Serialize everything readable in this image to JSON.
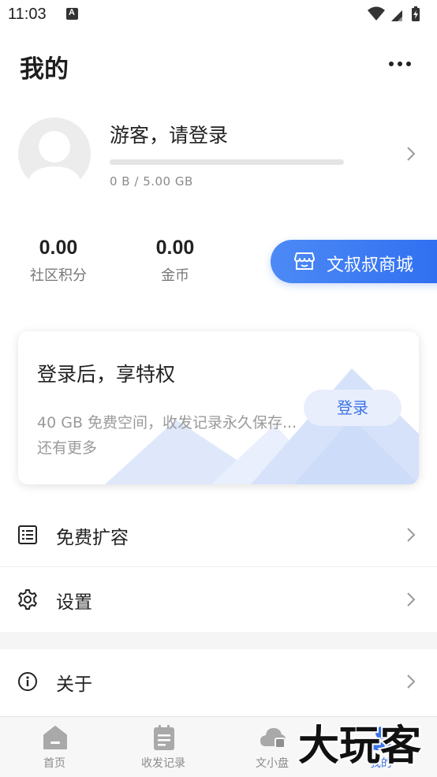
{
  "status_bar": {
    "time": "11:03",
    "notification_letter": "A",
    "icons": [
      "wifi-icon",
      "signal-icon",
      "battery-icon"
    ]
  },
  "header": {
    "title": "我的",
    "more_icon": "more-icon"
  },
  "profile": {
    "name": "游客，请登录",
    "storage_text": "0 B / 5.00 GB",
    "storage_used_fraction": 0,
    "avatar_icon": "avatar-placeholder-icon"
  },
  "stats": [
    {
      "value": "0.00",
      "label": "社区积分"
    },
    {
      "value": "0.00",
      "label": "金币"
    }
  ],
  "shop_button": {
    "label": "文叔叔商城",
    "icon": "store-icon"
  },
  "login_card": {
    "title": "登录后，享特权",
    "description": "40 GB 免费空间，收发记录永久保存... 还有更多",
    "button_label": "登录"
  },
  "menu": [
    {
      "label": "免费扩容",
      "icon": "list-icon"
    },
    {
      "label": "设置",
      "icon": "gear-icon"
    },
    {
      "label": "关于",
      "icon": "info-icon"
    }
  ],
  "bottom_nav": [
    {
      "label": "首页",
      "icon": "home-icon",
      "active": false
    },
    {
      "label": "收发记录",
      "icon": "clipboard-icon",
      "active": false
    },
    {
      "label": "文小盘",
      "icon": "cloud-drive-icon",
      "active": false
    },
    {
      "label": "我的",
      "icon": "user-icon",
      "active": true
    }
  ],
  "colors": {
    "accent": "#3d73e6",
    "shop_gradient_start": "#4d8af6",
    "shop_gradient_end": "#2f6ef0",
    "muted_text": "#8a8a8a"
  },
  "watermark": {
    "text": "大玩客"
  }
}
